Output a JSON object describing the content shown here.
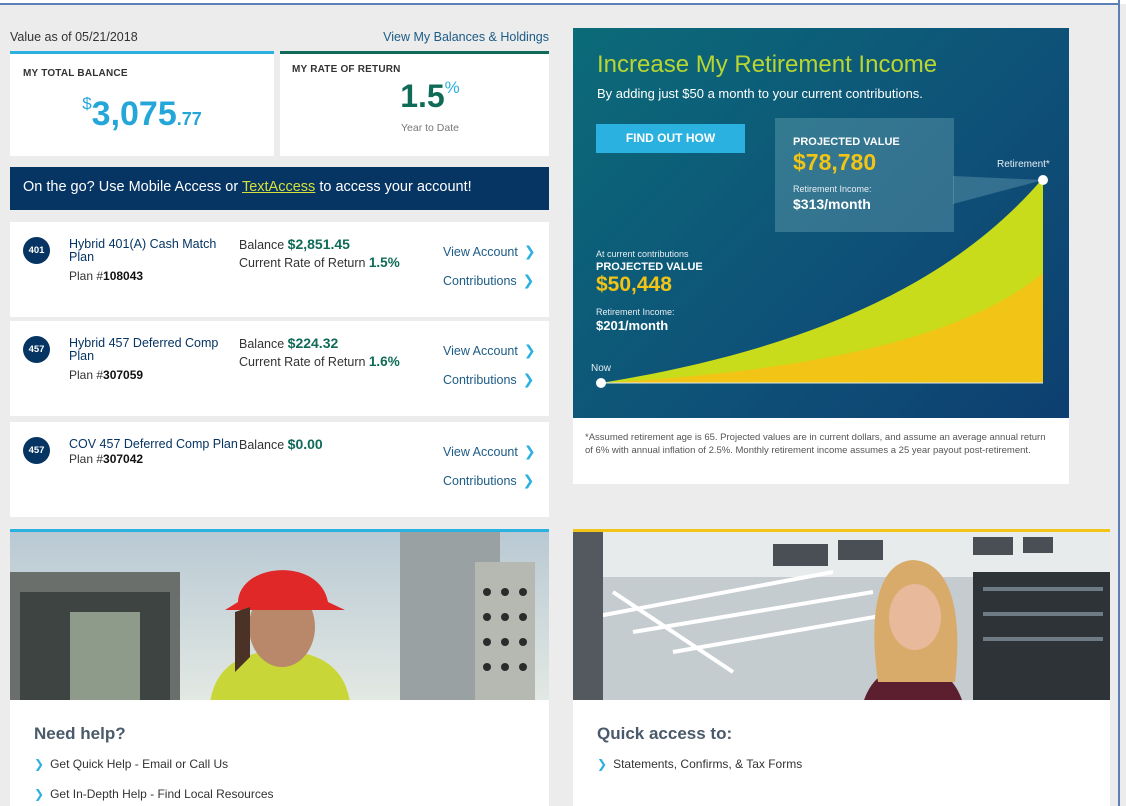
{
  "header": {
    "value_as_of": "Value as of 05/21/2018",
    "view_balances": "View My Balances & Holdings"
  },
  "total_balance": {
    "label": "MY TOTAL BALANCE",
    "dollar_sign": "$",
    "whole": "3,075",
    "cents": ".77"
  },
  "rate_of_return": {
    "label": "MY RATE OF RETURN",
    "value": "1.5",
    "percent": "%",
    "period": "Year to Date"
  },
  "mobile_banner": {
    "prefix": "On the go? Use Mobile Access or ",
    "link": "TextAccess",
    "suffix": " to access your account!"
  },
  "plans": [
    {
      "badge": "401",
      "name": "Hybrid 401(A) Cash Match Plan",
      "plan_prefix": "Plan #",
      "plan_number": "108043",
      "balance_label": "Balance ",
      "balance": "$2,851.45",
      "ror_label": "Current Rate of Return ",
      "ror": "1.5%",
      "view_account": "View Account",
      "contributions": "Contributions"
    },
    {
      "badge": "457",
      "name": "Hybrid 457 Deferred Comp Plan",
      "plan_prefix": "Plan #",
      "plan_number": "307059",
      "balance_label": "Balance ",
      "balance": "$224.32",
      "ror_label": "Current Rate of Return ",
      "ror": "1.6%",
      "view_account": "View Account",
      "contributions": "Contributions"
    },
    {
      "badge": "457",
      "name": "COV 457 Deferred Comp Plan",
      "plan_prefix": "Plan #",
      "plan_number": "307042",
      "balance_label": "Balance ",
      "balance": "$0.00",
      "view_account": "View Account",
      "contributions": "Contributions"
    }
  ],
  "promo": {
    "title": "Increase My Retirement Income",
    "subtitle": "By adding just $50 a month to your current contributions.",
    "button": "FIND OUT HOW",
    "projected": {
      "label": "PROJECTED VALUE",
      "value": "$78,780",
      "income_label": "Retirement Income:",
      "income": "$313/month"
    },
    "current": {
      "caption": "At current contributions",
      "label": "PROJECTED VALUE",
      "value": "$50,448",
      "income_label": "Retirement Income:",
      "income": "$201/month"
    },
    "now_label": "Now",
    "retirement_label": "Retirement*",
    "chart_data": {
      "type": "area",
      "x": [
        "Now",
        "Retirement*"
      ],
      "series": [
        {
          "values": [
            0,
            78780
          ],
          "color": "#c8dc1c"
        },
        {
          "values": [
            0,
            50448
          ],
          "color": "#f2c416"
        }
      ]
    },
    "disclaimer": "*Assumed retirement age is 65. Projected values are in current dollars, and assume an average annual return of 6% with annual inflation of 2.5%. Monthly retirement income assumes a 25 year payout post-retirement."
  },
  "help": {
    "title": "Need help?",
    "links": [
      "Get Quick Help - Email or Call Us",
      "Get In-Depth Help - Find Local Resources"
    ]
  },
  "quick_access": {
    "title": "Quick access to:",
    "links": [
      "Statements, Confirms, & Tax Forms"
    ]
  },
  "colors": {
    "navy": "#063463",
    "cyan": "#2bb1df",
    "green": "#0f6b58",
    "lime": "#c8dc1c",
    "gold": "#f2c416"
  }
}
